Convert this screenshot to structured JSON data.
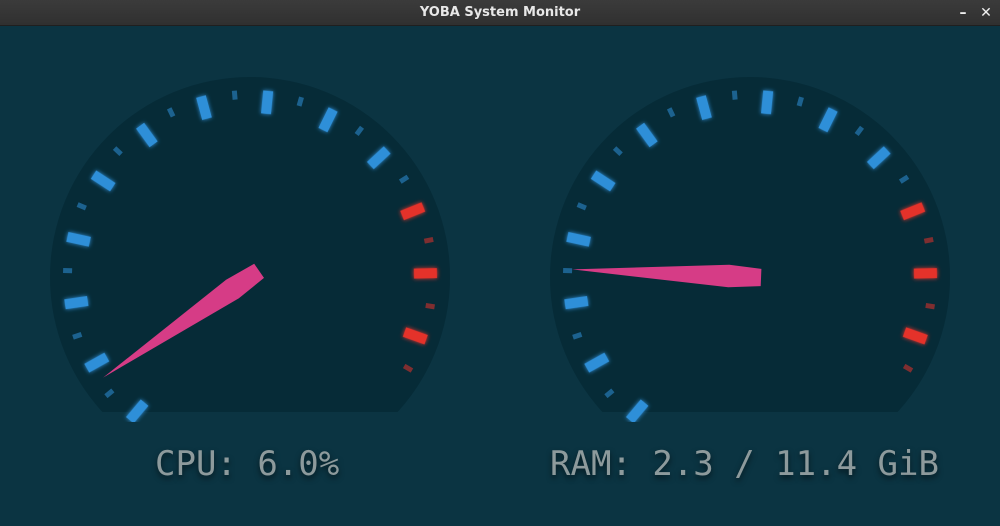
{
  "window": {
    "title": "YOBA System Monitor",
    "minimize_glyph": "–",
    "close_glyph": "✕"
  },
  "colors": {
    "background": "#0b3442",
    "dial_face": "#062b37",
    "tick_normal": "#2f8fd8",
    "tick_danger": "#e4322c",
    "needle": "#d63c86",
    "label_text": "#8d9a9c"
  },
  "cpu": {
    "label": "CPU: 6.0%",
    "value_percent": 6.0,
    "danger_from_fraction": 0.8
  },
  "ram": {
    "label": "RAM: 2.3 / 11.4 GiB",
    "used_gib": 2.3,
    "total_gib": 11.4,
    "danger_from_fraction": 0.8
  }
}
